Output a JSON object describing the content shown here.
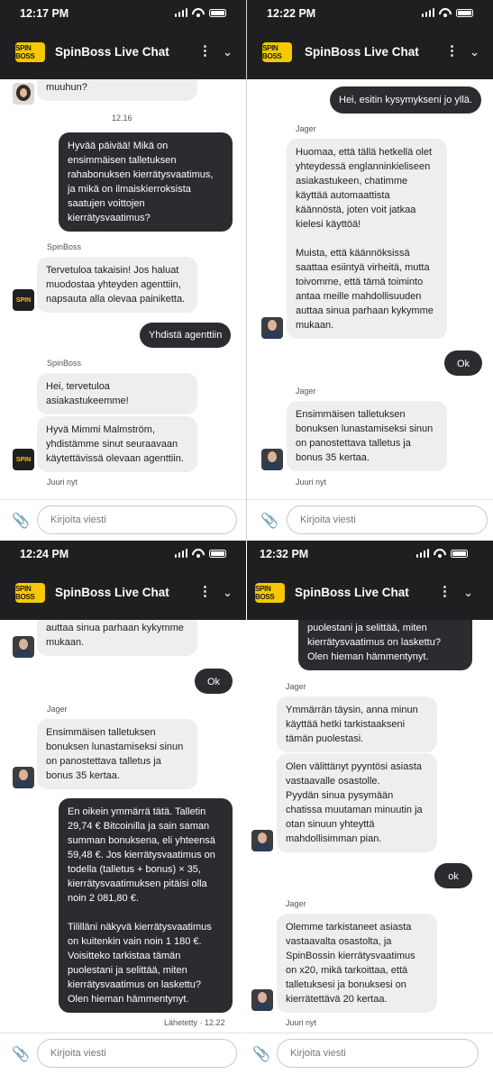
{
  "app": {
    "title": "SpinBoss Live Chat",
    "logo_text": "SPIN BOSS",
    "kebab_glyph": "⋮",
    "chevron_glyph": "⌄",
    "attach_glyph": "📎",
    "input_placeholder": "Kirjoita viesti"
  },
  "panels": [
    {
      "time": "12:17 PM",
      "messages": [
        {
          "text": "muuhun?"
        },
        {
          "text": "12.16"
        },
        {
          "text": "Hyvää päivää! Mikä on\nensimmäisen talletuksen\nrahabonuksen kierrätysvaatimus,\nja mikä on ilmaiskierroksista\nsaatujen voittojen\nkierrätysvaatimus?"
        },
        {
          "text": "SpinBoss"
        },
        {
          "text": "Tervetuloa takaisin! Jos haluat\nmuodostaa yhteyden agenttiin,\nnapsauta alla olevaa painiketta."
        },
        {
          "text": "Yhdistä agenttiin"
        },
        {
          "text": "SpinBoss"
        },
        {
          "text": "Hei, tervetuloa\nasiakastukeemme!"
        },
        {
          "text": "Hyvä Mimmi Malmström,\nyhdistämme sinut seuraavaan\nkäytettävissä olevaan agenttiin."
        },
        {
          "text": "Juuri nyt"
        }
      ]
    },
    {
      "time": "12:22 PM",
      "messages": [
        {
          "text": "Hei, esitin kysymykseni jo yllä."
        },
        {
          "text": "Jager"
        },
        {
          "text": "Huomaa, että tällä hetkellä olet\nyhteydessä englanninkieliseen\nasiakastukeen, chatimme\nkäyttää automaattista\nkäännöstä, joten voit jatkaa\nkielesi käyttöä!\n\nMuista, että käännöksissä\nsaattaa esiintyä virheitä, mutta\ntoivomme, että tämä toiminto\nantaa meille mahdollisuuden\nauttaa sinua parhaan kykymme\nmukaan."
        },
        {
          "text": "Ok"
        },
        {
          "text": "Jager"
        },
        {
          "text": "Ensimmäisen talletuksen\nbonuksen lunastamiseksi sinun\non panostettava talletus ja\nbonus 35 kertaa."
        },
        {
          "text": "Juuri nyt"
        }
      ]
    },
    {
      "time": "12:24 PM",
      "messages": [
        {
          "text": "auttaa sinua parhaan kykymme\nmukaan."
        },
        {
          "text": "Ok"
        },
        {
          "text": "Jager"
        },
        {
          "text": "Ensimmäisen talletuksen\nbonuksen lunastamiseksi sinun\non panostettava talletus ja\nbonus 35 kertaa."
        },
        {
          "text": "En oikein ymmärrä tätä. Talletin\n29,74 € Bitcoinilla ja sain saman\nsumman bonuksena, eli yhteensä\n59,48 €. Jos kierrätysvaatimus on\ntodella (talletus + bonus) × 35,\nkierrätysvaatimuksen pitäisi olla\nnoin 2 081,80 €.\n\nTililläni näkyvä kierrätysvaatimus\non kuitenkin vain noin 1 180 €.\nVoisitteko tarkistaa tämän\npuolestani ja selittää, miten\nkierrätysvaatimus on laskettu?\nOlen hieman hämmentynyt."
        },
        {
          "text": "Lähetetty · 12.22"
        }
      ]
    },
    {
      "time": "12:32 PM",
      "messages": [
        {
          "text": "puolestani ja selittää, miten\nkierrätysvaatimus on laskettu?\nOlen hieman hämmentynyt."
        },
        {
          "text": "Jager"
        },
        {
          "text": "Ymmärrän täysin, anna minun\nkäyttää hetki tarkistaakseni\ntämän puolestasi."
        },
        {
          "text": "Olen välittänyt pyyntösi asiasta\nvastaavalle osastolle.\nPyydän sinua pysymään\nchatissa muutaman minuutin ja\notan sinuun yhteyttä\nmahdollisimman pian."
        },
        {
          "text": "ok"
        },
        {
          "text": "Jager"
        },
        {
          "text": "Olemme tarkistaneet asiasta\nvastaavalta osastolta, ja\nSpinBossin kierrätysvaatimus\non x20, mikä tarkoittaa, että\ntalletuksesi ja bonuksesi on\nkierrätettävä 20 kertaa."
        },
        {
          "text": "Juuri nyt"
        }
      ]
    }
  ]
}
